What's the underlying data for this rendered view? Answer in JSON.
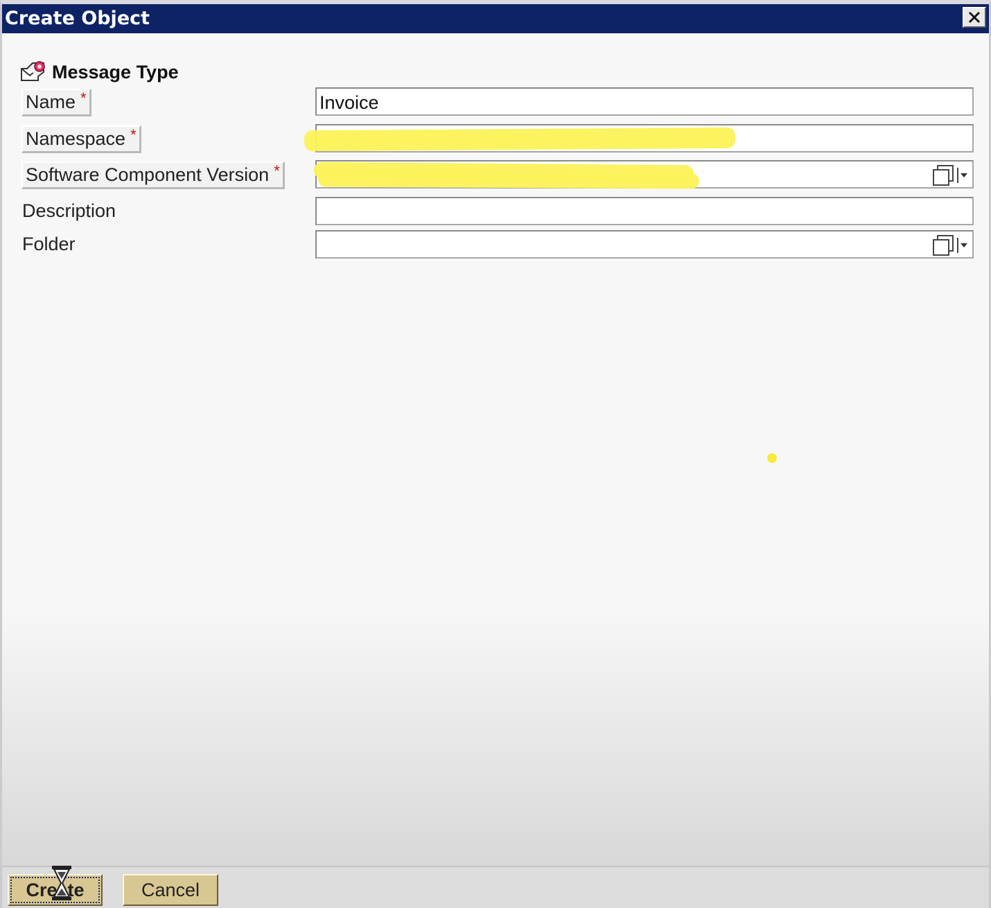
{
  "window": {
    "title": "Create Object",
    "close_glyph": "✕"
  },
  "header": {
    "icon": "message-type-icon",
    "title": "Message Type"
  },
  "form": {
    "name": {
      "label": "Name",
      "required_mark": "*",
      "value": "Invoice"
    },
    "namespace": {
      "label": "Namespace",
      "required_mark": "*",
      "value": ""
    },
    "software_component_version": {
      "label": "Software Component Version",
      "required_mark": "*",
      "value": "",
      "dropdown_icon": "value-help-dropdown-icon"
    },
    "description": {
      "label": "Description",
      "value": ""
    },
    "folder": {
      "label": "Folder",
      "value": "",
      "dropdown_icon": "value-help-dropdown-icon"
    }
  },
  "footer": {
    "create_label": "Create",
    "cancel_label": "Cancel"
  },
  "colors": {
    "titlebar": "#0e2366",
    "required": "#cc1111",
    "button": "#d8c792",
    "redaction": "#fbf35a"
  }
}
